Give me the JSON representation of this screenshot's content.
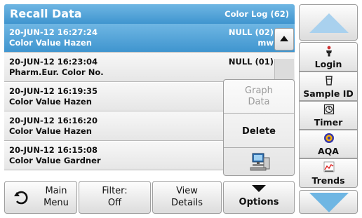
{
  "header": {
    "title": "Recall Data",
    "log_label": "Color Log (62)"
  },
  "rows": [
    {
      "datetime": "20-JUN-12  16:27:24",
      "method": "Color Value Hazen",
      "result": "NULL (02)",
      "unit": "mw",
      "selected": true
    },
    {
      "datetime": "20-JUN-12  16:23:04",
      "method": "Pharm.Eur. Color No.",
      "result": "NULL (01)",
      "unit": "",
      "selected": false
    },
    {
      "datetime": "20-JUN-12  16:19:35",
      "method": "Color Value Hazen",
      "result": "",
      "unit": "",
      "selected": false
    },
    {
      "datetime": "20-JUN-12  16:16:20",
      "method": "Color Value Hazen",
      "result": "",
      "unit": "",
      "selected": false
    },
    {
      "datetime": "20-JUN-12  16:15:08",
      "method": "Color Value Gardner",
      "result": "",
      "unit": "",
      "selected": false
    }
  ],
  "options_popup": {
    "graph_line1": "Graph",
    "graph_line2": "Data",
    "delete": "Delete",
    "network_icon": "network-computer-icon"
  },
  "bottom_bar": {
    "main_line1": "Main",
    "main_line2": "Menu",
    "filter_line1": "Filter:",
    "filter_line2": "Off",
    "view_line1": "View",
    "view_line2": "Details",
    "options": "Options"
  },
  "right_panel": {
    "login": "Login",
    "sample_id": "Sample ID",
    "timer": "Timer",
    "aqa": "AQA",
    "trends": "Trends"
  },
  "colors": {
    "accent": "#3f95cf",
    "arrow_light": "#a9d1ee",
    "disabled_text": "#9a9a9a"
  }
}
